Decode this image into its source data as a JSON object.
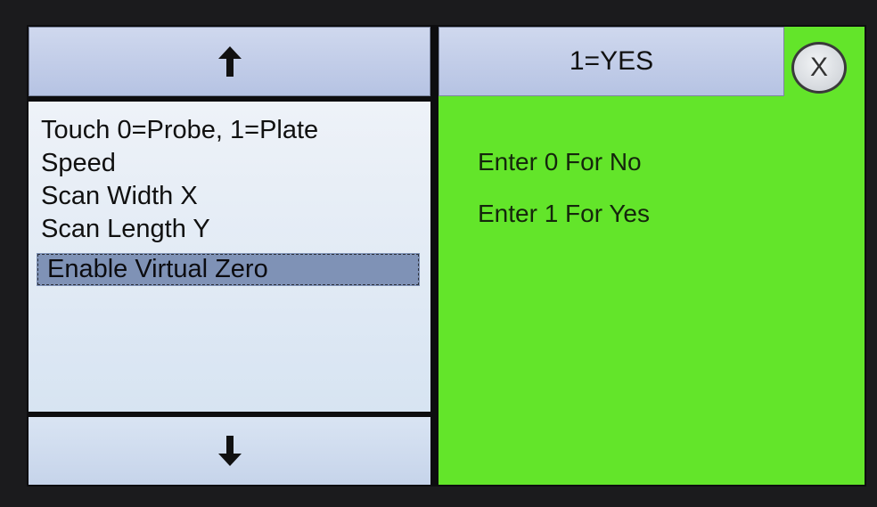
{
  "nav": {
    "up_icon": "arrow-up-icon",
    "down_icon": "arrow-down-icon"
  },
  "menu": {
    "items": [
      "Touch 0=Probe, 1=Plate",
      "Speed",
      "Scan Width X",
      "Scan Length Y",
      "Enable Virtual Zero"
    ],
    "selected_index": 4
  },
  "value_button": {
    "label": "1=YES"
  },
  "close_button": {
    "label": "X"
  },
  "help": {
    "lines": [
      "Enter 0 For No",
      "Enter 1 For Yes"
    ]
  },
  "colors": {
    "help_panel": "#63e52a",
    "button_face": "#c3cdea",
    "selection": "#7f92b6"
  }
}
